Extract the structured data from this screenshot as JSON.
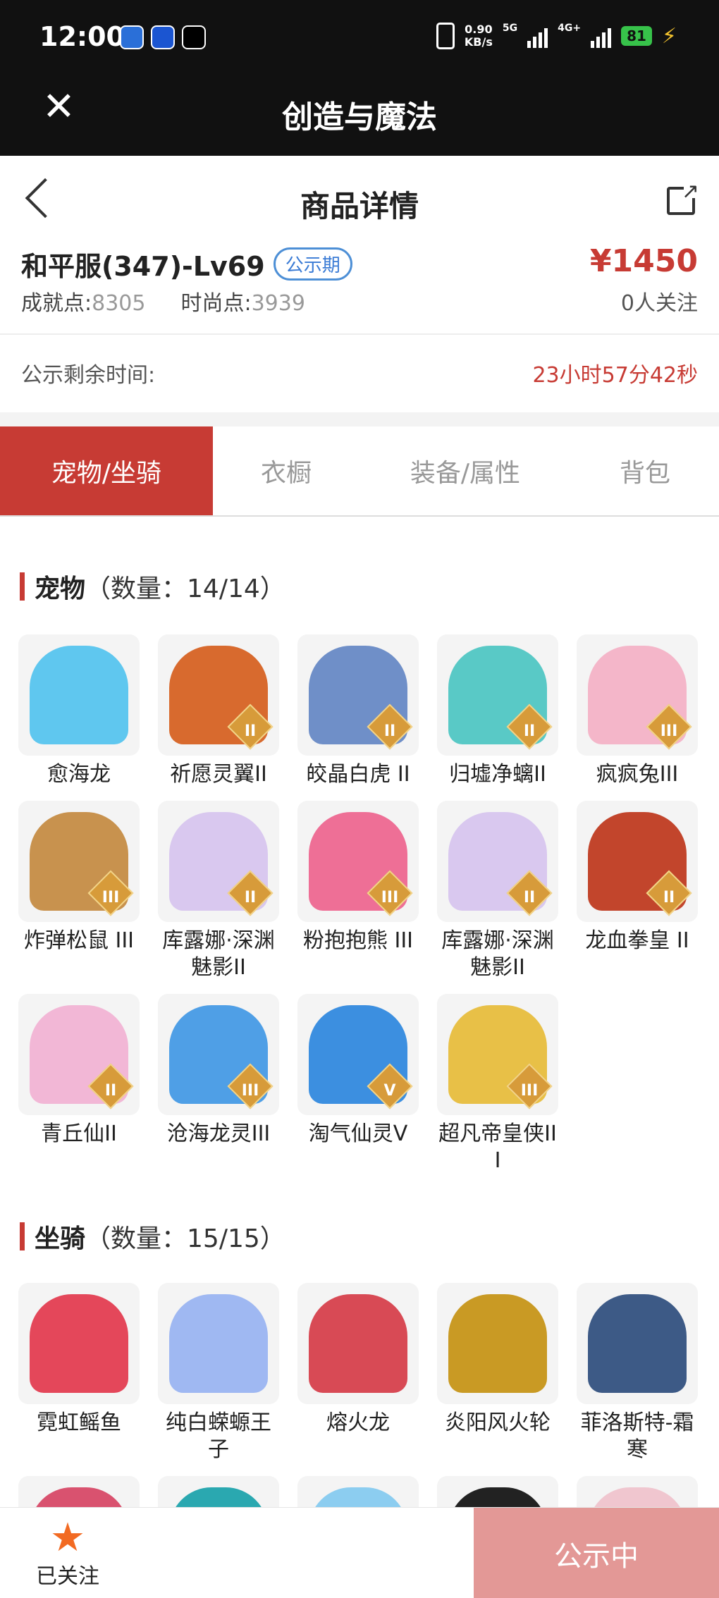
{
  "status_bar": {
    "time": "12:00",
    "net_speed_top": "0.90",
    "net_speed_bottom": "KB/s",
    "sig1_tag": "5G",
    "sig2_tag": "4G+",
    "battery": "81"
  },
  "app_header": {
    "title": "创造与魔法"
  },
  "nav": {
    "title": "商品详情"
  },
  "listing": {
    "server": "和平服(347)-Lv69",
    "badge": "公示期",
    "achievement_label": "成就点:",
    "achievement_value": "8305",
    "fashion_label": "时尚点:",
    "fashion_value": "3939",
    "price": "¥1450",
    "followers": "0人关注"
  },
  "remaining": {
    "label": "公示剩余时间:",
    "value": "23小时57分42秒"
  },
  "tabs": [
    {
      "label": "宠物/坐骑",
      "active": true
    },
    {
      "label": "衣橱",
      "active": false
    },
    {
      "label": "装备/属性",
      "active": false
    },
    {
      "label": "背包",
      "active": false
    }
  ],
  "pets": {
    "title": "宠物",
    "count": "（数量：14/14）",
    "items": [
      {
        "name": "愈海龙",
        "grade": "",
        "color": "#5fc7ef"
      },
      {
        "name": "祈愿灵翼II",
        "grade": "II",
        "color": "#d86a2e"
      },
      {
        "name": "皎晶白虎 II",
        "grade": "II",
        "color": "#6f8fc8"
      },
      {
        "name": "归墟净螭II",
        "grade": "II",
        "color": "#59c9c6"
      },
      {
        "name": "疯疯兔III",
        "grade": "III",
        "color": "#f4b6c9"
      },
      {
        "name": "炸弹松鼠 III",
        "grade": "III",
        "color": "#c8924e"
      },
      {
        "name": "库露娜·深渊魅影II",
        "grade": "II",
        "color": "#d9c8ef"
      },
      {
        "name": "粉抱抱熊 III",
        "grade": "III",
        "color": "#ee6f96"
      },
      {
        "name": "库露娜·深渊魅影II",
        "grade": "II",
        "color": "#d9c8ef"
      },
      {
        "name": "龙血拳皇 II",
        "grade": "II",
        "color": "#c2452c"
      },
      {
        "name": "青丘仙II",
        "grade": "II",
        "color": "#f2b7d6"
      },
      {
        "name": "沧海龙灵III",
        "grade": "III",
        "color": "#4f9fe6"
      },
      {
        "name": "淘气仙灵V",
        "grade": "V",
        "color": "#3c8fe0"
      },
      {
        "name": "超凡帝皇侠III",
        "grade": "III",
        "color": "#e8c047"
      }
    ]
  },
  "mounts": {
    "title": "坐骑",
    "count": "（数量：15/15）",
    "items": [
      {
        "name": "霓虹鳐鱼",
        "grade": "",
        "color": "#e4475a"
      },
      {
        "name": "纯白蝾螈王子",
        "grade": "",
        "color": "#9fb8f2"
      },
      {
        "name": "熔火龙",
        "grade": "",
        "color": "#d84a55"
      },
      {
        "name": "炎阳风火轮",
        "grade": "",
        "color": "#c99a24"
      },
      {
        "name": "菲洛斯特-霜寒",
        "grade": "",
        "color": "#3d5a86"
      },
      {
        "name": "",
        "grade": "",
        "color": "#d9526f"
      },
      {
        "name": "",
        "grade": "",
        "color": "#2aa8b0"
      },
      {
        "name": "",
        "grade": "",
        "color": "#8ccdf0"
      },
      {
        "name": "",
        "grade": "",
        "color": "#222222"
      },
      {
        "name": "",
        "grade": "",
        "color": "#f0c6cf"
      }
    ]
  },
  "bottom": {
    "follow_label": "已关注",
    "cta": "公示中"
  }
}
